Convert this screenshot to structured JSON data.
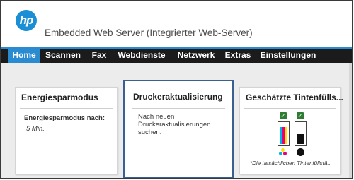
{
  "app": {
    "logo_text": "hp",
    "title": "Embedded Web Server (Integrierter Web-Server)"
  },
  "nav": {
    "items": [
      {
        "label": "Home",
        "active": true
      },
      {
        "label": "Scannen"
      },
      {
        "label": "Fax"
      },
      {
        "label": "Webdienste"
      },
      {
        "label": "Netzwerk"
      },
      {
        "label": "Extras"
      },
      {
        "label": "Einstellungen"
      }
    ]
  },
  "cards": {
    "power": {
      "title": "Energiesparmodus",
      "label": "Energiesparmodus nach:",
      "value": "5 Min."
    },
    "update": {
      "title": "Druckeraktualisierung",
      "line1": "Nach neuen",
      "line2": "Druckeraktualisierungen",
      "line3": "suchen."
    },
    "ink": {
      "title": "Geschätzte Tintenfülls...",
      "note": "*Die tatsächlichen Tintenfüllstä...",
      "cartridges": [
        {
          "name": "color",
          "status": "ok",
          "level": 0.75,
          "colors": [
            "#00b4e6",
            "#e6007e",
            "#ffe100"
          ]
        },
        {
          "name": "black",
          "status": "ok",
          "level": 0.45,
          "colors": [
            "#111111"
          ]
        }
      ]
    }
  },
  "colors": {
    "accent": "#2b8bd0",
    "nav_bg": "#1b1b1b",
    "logo": "#1a8fd6",
    "check": "#2e7d32"
  }
}
